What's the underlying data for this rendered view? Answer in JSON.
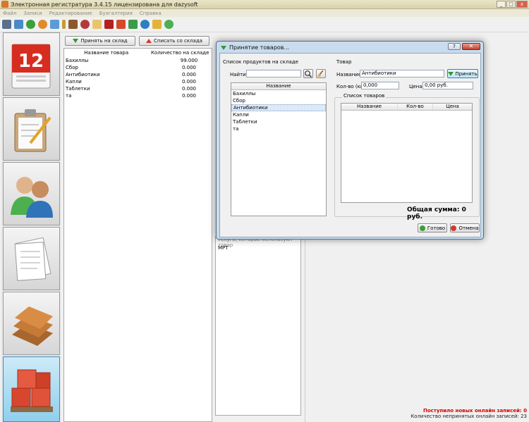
{
  "window": {
    "title": "Электронная регистратура 3.4.15 лицензирована для dazysoft",
    "controls": [
      "_",
      "□",
      "x"
    ]
  },
  "menu": [
    "Файл",
    "Записи",
    "Редактирование",
    "Бухгалтерия",
    "Справка"
  ],
  "toolbar_icons": [
    "save-icon",
    "print-icon",
    "add-patient-icon",
    "record-icon",
    "home-icon",
    "pin-icon",
    "book-icon",
    "scissors-icon",
    "notes-icon",
    "stop-icon",
    "box-icon",
    "money-icon",
    "user-icon",
    "export-icon",
    "chat-icon"
  ],
  "sidebar": [
    {
      "name": "calendar",
      "label": "12"
    },
    {
      "name": "clipboard"
    },
    {
      "name": "patients"
    },
    {
      "name": "documents"
    },
    {
      "name": "books"
    },
    {
      "name": "warehouse",
      "active": true
    }
  ],
  "stock": {
    "receive_label": "Принять на склад",
    "writeoff_label": "Списать со склада",
    "columns": [
      "Название товара",
      "Количество на складе"
    ],
    "rows": [
      {
        "name": "Бахиллы",
        "qty": "99.000"
      },
      {
        "name": "Сбор",
        "qty": "0.000"
      },
      {
        "name": "Антибиотики",
        "qty": "0.000"
      },
      {
        "name": "Капли",
        "qty": "0.000"
      },
      {
        "name": "Таблетки",
        "qty": "0.000"
      },
      {
        "name": "та",
        "qty": "0.000"
      }
    ]
  },
  "background": {
    "cut_text": "Услуги, которые используют товар",
    "list_item": "МРТ"
  },
  "status": {
    "new_online": "Поступило новых онлайн записей: 0",
    "unaccepted": "Количество непринятых онлайн записей: 23"
  },
  "dialog": {
    "title": "Принятие товаров...",
    "help": "?",
    "left": {
      "caption": "Список продуктов на складе",
      "find_label": "Найти:",
      "find_value": "",
      "list_header": "Название",
      "items": [
        "Бахиллы",
        "Сбор",
        "Антибиотики",
        "Капли",
        "Таблетки",
        "та"
      ],
      "selected_index": 2
    },
    "right": {
      "caption": "Товар",
      "name_label": "Название:",
      "name_value": "Антибиотики",
      "accept_label": "Принять",
      "qty_label": "Кол-во (кг):",
      "qty_value": "0,000",
      "price_label": "Цена:",
      "price_value": "0,00 руб.",
      "goods_caption": "Список товаров",
      "columns": [
        "Название",
        "Кол-во",
        "Цена"
      ],
      "total": "Общая сумма: 0 руб."
    },
    "ok_label": "Готово",
    "cancel_label": "Отмена"
  },
  "colors": {
    "accent_green": "#2f9b2f",
    "accent_red": "#d23a2a",
    "status_red": "#d40000",
    "dialog_frame": "#c9dcee"
  }
}
